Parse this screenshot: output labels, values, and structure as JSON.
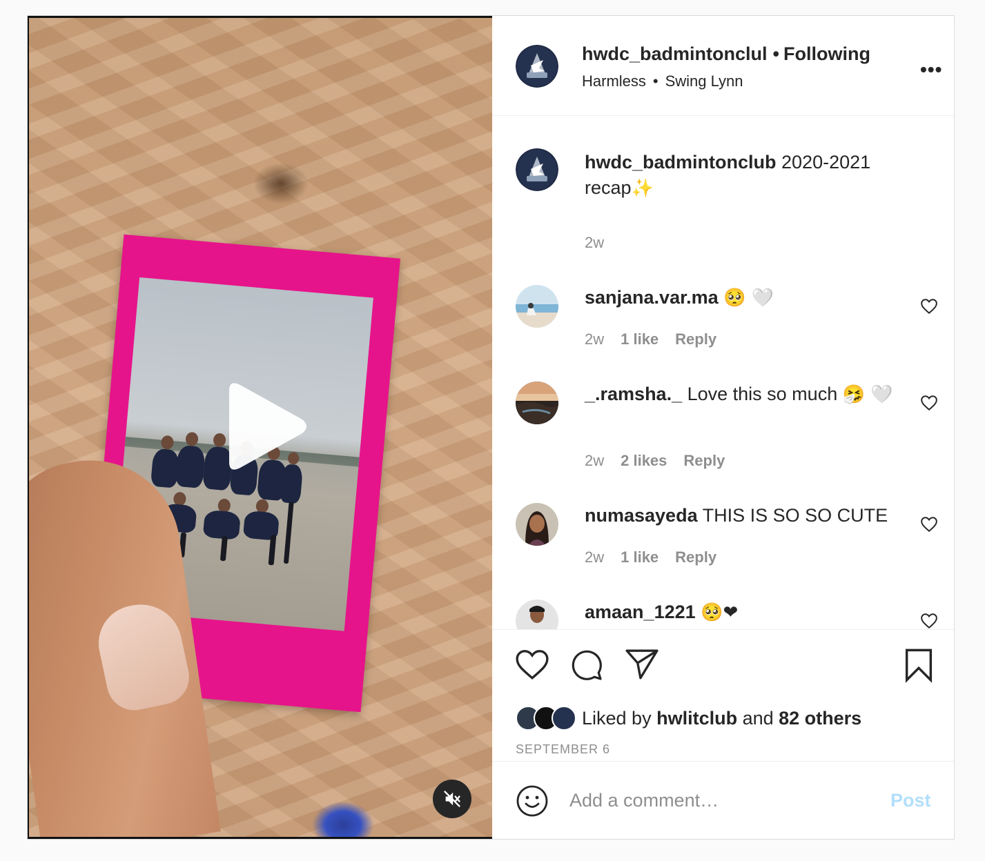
{
  "header": {
    "username": "hwdc_badmintonclul",
    "follow_status": "Following",
    "separator": "•",
    "audio_artist": "Harmless",
    "audio_track": "Swing Lynn",
    "more_label": "•••"
  },
  "caption": {
    "username": "hwdc_badmintonclub",
    "text": " 2020-2021 recap",
    "emoji": "✨",
    "time": "2w"
  },
  "comments": [
    {
      "username": "sanjana.var.ma",
      "text": "",
      "emoji": "🥺 🤍",
      "time": "2w",
      "likes": "1 like",
      "reply": "Reply"
    },
    {
      "username": "_.ramsha._",
      "text": " Love this so much ",
      "emoji": "🤧 🤍",
      "time": "2w",
      "likes": "2 likes",
      "reply": "Reply"
    },
    {
      "username": "numasayeda",
      "text": " THIS IS SO SO CUTE",
      "emoji": "",
      "time": "2w",
      "likes": "1 like",
      "reply": "Reply"
    },
    {
      "username": "amaan_1221",
      "text": "",
      "emoji": "🥺❤",
      "time": "",
      "likes": "",
      "reply": ""
    }
  ],
  "likes": {
    "prefix": "Liked by ",
    "user": "hwlitclub",
    "middle": " and ",
    "others": "82 others"
  },
  "date": "SEPTEMBER 6",
  "add_comment": {
    "placeholder": "Add a comment…",
    "post_label": "Post"
  },
  "colors": {
    "post_button_disabled": "#b2dffc",
    "polaroid_frame": "#e6148a",
    "muted_text": "#8e8e8e"
  }
}
